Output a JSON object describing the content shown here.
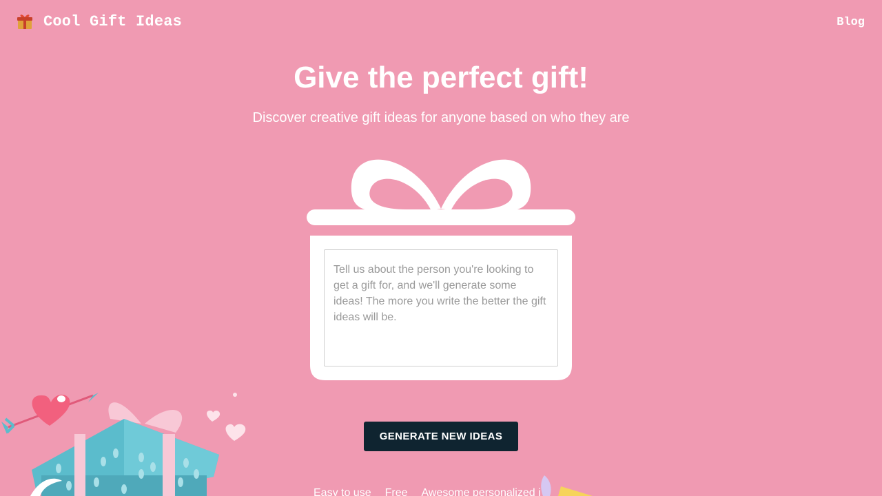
{
  "header": {
    "logo_text": "Cool Gift Ideas",
    "logo_icon": "gift-box-icon",
    "blog_label": "Blog"
  },
  "hero": {
    "title": "Give the perfect gift!",
    "subtitle": "Discover creative gift ideas for anyone based on who they are"
  },
  "prompt": {
    "placeholder": "Tell us about the person you're looking to get a gift for, and we'll generate some ideas! The more you write the better the gift ideas will be.",
    "value": ""
  },
  "actions": {
    "generate_label": "GENERATE NEW IDEAS"
  },
  "features": [
    "Easy to use",
    "Free",
    "Awesome personalized i"
  ],
  "colors": {
    "background": "#f09ab2",
    "button": "#0f2430",
    "gift_teal": "#5bbccc",
    "heart": "#f2607e"
  }
}
